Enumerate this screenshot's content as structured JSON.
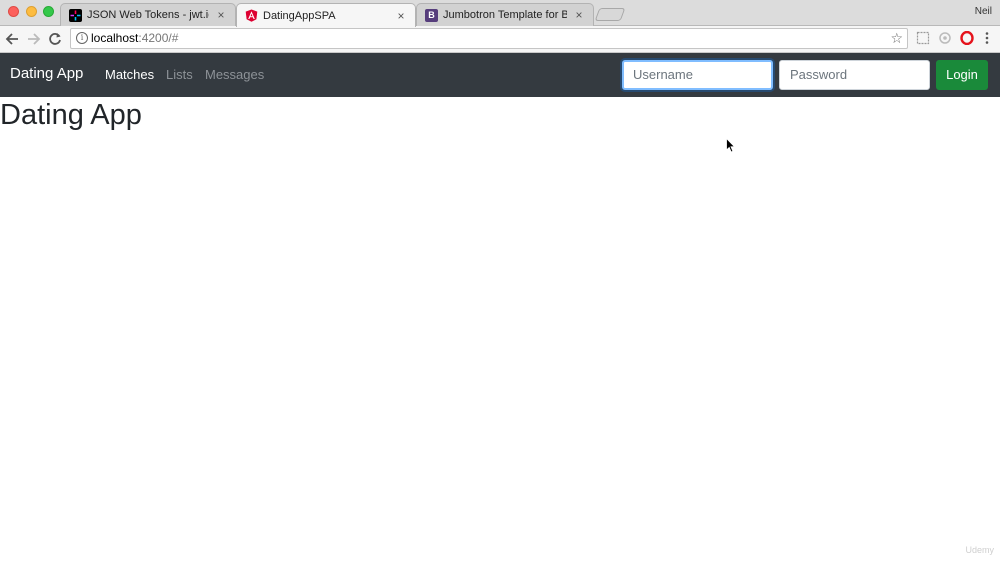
{
  "browser": {
    "tabs": [
      {
        "title": "JSON Web Tokens - jwt.io",
        "close": "×",
        "favicon": "jwt-icon"
      },
      {
        "title": "DatingAppSPA",
        "close": "×",
        "favicon": "angular-icon"
      },
      {
        "title": "Jumbotron Template for Boots",
        "close": "×",
        "favicon": "bootstrap-icon",
        "favicon_letter": "B"
      }
    ],
    "profile_name": "Neil",
    "url_host": "localhost",
    "url_path": ":4200/#"
  },
  "navbar": {
    "brand": "Dating App",
    "links": [
      {
        "label": "Matches",
        "state": "active"
      },
      {
        "label": "Lists",
        "state": "muted"
      },
      {
        "label": "Messages",
        "state": "muted"
      }
    ],
    "username_placeholder": "Username",
    "password_placeholder": "Password",
    "login_label": "Login",
    "login_color": "#1a8a3a",
    "navbar_color": "#343a40"
  },
  "main": {
    "heading": "Dating App"
  },
  "watermark": "Udemy"
}
